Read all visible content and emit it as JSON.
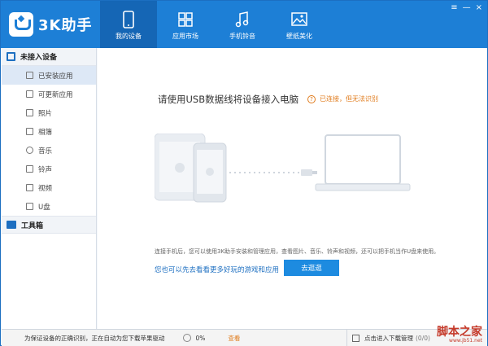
{
  "app": {
    "logo_text": "3K助手",
    "window_controls": [
      "≡",
      "—",
      "×"
    ],
    "accent": "#1d7fd6",
    "link_color": "#1d6fc1",
    "warning_color": "#e07b1c"
  },
  "nav": {
    "tabs": [
      {
        "label": "我的设备",
        "icon": "phone-icon",
        "active": true
      },
      {
        "label": "应用市场",
        "icon": "grid-icon",
        "active": false
      },
      {
        "label": "手机铃音",
        "icon": "music-note-icon",
        "active": false
      },
      {
        "label": "壁纸美化",
        "icon": "image-icon",
        "active": false
      }
    ]
  },
  "sidebar": {
    "header": "未接入设备",
    "items": [
      {
        "label": "已安装应用",
        "icon": "apps-icon",
        "active": true
      },
      {
        "label": "可更新应用",
        "icon": "update-icon",
        "active": false
      },
      {
        "label": "照片",
        "icon": "photo-icon",
        "active": false
      },
      {
        "label": "相簿",
        "icon": "album-icon",
        "active": false
      },
      {
        "label": "音乐",
        "icon": "music-icon",
        "active": false
      },
      {
        "label": "铃声",
        "icon": "ringtone-icon",
        "active": false
      },
      {
        "label": "视频",
        "icon": "video-icon",
        "active": false
      },
      {
        "label": "U盘",
        "icon": "usb-drive-icon",
        "active": false
      }
    ],
    "toolbox": "工具箱"
  },
  "main": {
    "headline": "请使用USB数据线将设备接入电脑",
    "status": "已连接，但无法识别",
    "description": "连接手机后，您可以使用3K助手安装和管理应用，查看图片、音乐、铃声和视频，还可以把手机当作U盘来使用。",
    "more_link": "您也可以先去看看更多好玩的游戏和应用",
    "go_button": "去逛逛"
  },
  "statusbar": {
    "message": "为保证设备的正确识别，正在自动为您下载苹果驱动",
    "percent": "0%",
    "check_link": "查看",
    "download_manager": "点击进入下载管理",
    "download_count": "(0/0)",
    "watermark": "脚本之家",
    "watermark_url": "www.jb51.net"
  }
}
